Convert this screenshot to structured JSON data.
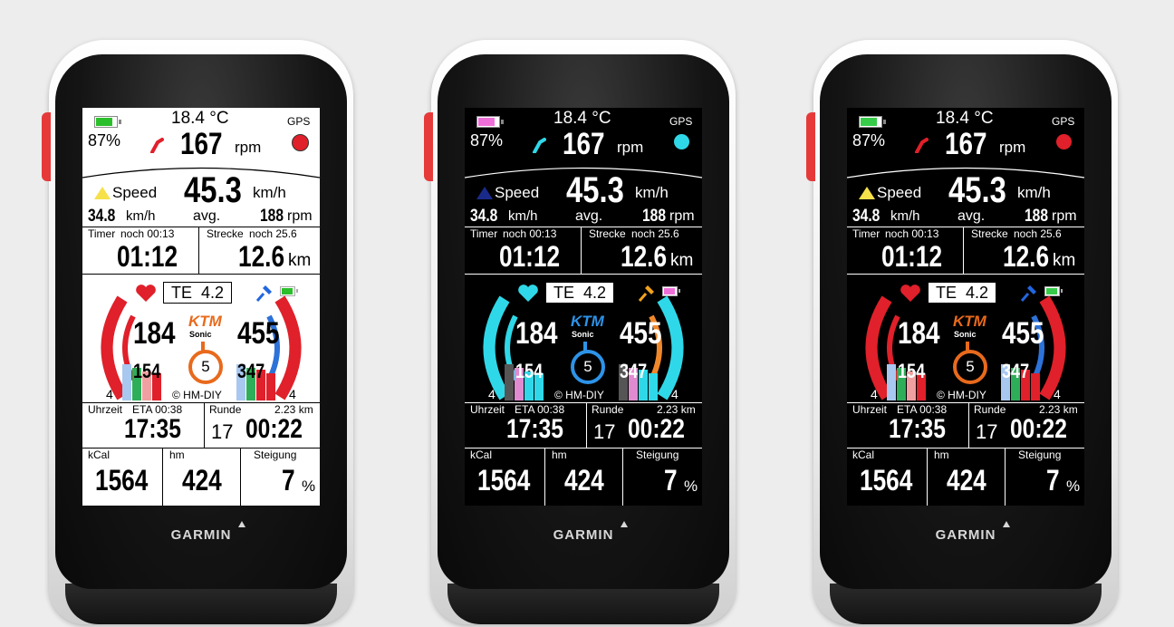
{
  "device": {
    "brand": "GARMIN"
  },
  "screen": {
    "temperature": "18.4 °C",
    "gps_label": "GPS",
    "battery_pct": "87%",
    "cadence_value": "167",
    "cadence_unit": "rpm",
    "speed_label": "Speed",
    "speed_value": "45.3",
    "speed_unit": "km/h",
    "avg_speed": "34.8",
    "avg_speed_unit": "km/h",
    "avg_label": "avg.",
    "avg_cadence": "188",
    "avg_cadence_unit": "rpm",
    "timer_label": "Timer",
    "timer_remaining": "noch 00:13",
    "timer_value": "01:12",
    "distance_label": "Strecke",
    "distance_remaining": "noch 25.6",
    "distance_value": "12.6",
    "distance_unit": "km",
    "te_label": "TE",
    "te_value": "4.2",
    "heart_rate": "184",
    "hr_avg": "154",
    "power": "455",
    "power_avg": "347",
    "left_zone": "4",
    "right_zone": "4",
    "ktm_logo": "KTM",
    "ktm_sub": "Sonic",
    "gear": "5",
    "copyright": "© HM-DIY",
    "clock_label": "Uhrzeit",
    "eta_label": "ETA 00:38",
    "clock_value": "17:35",
    "lap_label": "Runde",
    "lap_distance": "2.23 km",
    "lap_number": "17",
    "lap_time": "00:22",
    "kcal_label": "kCal",
    "kcal_value": "1564",
    "hm_label": "hm",
    "hm_value": "424",
    "grade_label": "Steigung",
    "grade_value": "7",
    "grade_unit": "%"
  },
  "variants": [
    {
      "theme": "white-red",
      "background": "#ffffff",
      "foreground": "#000000",
      "battery_color": "#2bbf2b",
      "cadence_icon_color": "#e0202a",
      "gps_dot_color": "#e0202a",
      "heart_color": "#e0202a",
      "pin_color": "#2266e0",
      "arc_left_color": "#e0202a",
      "arc_right_color": "#2d72d8",
      "arc_outer_color": "#e0202a",
      "gear_color": "#e86a1c",
      "speed_icon_color": "#f6e14a",
      "bar_colors_left": [
        "#a8c8f0",
        "#2fae5a",
        "#f0a0a0",
        "#e0202a"
      ],
      "bar_colors_right": [
        "#a8c8f0",
        "#2fae5a",
        "#e0202a",
        "#e0202a"
      ]
    },
    {
      "theme": "black-cyan",
      "background": "#000000",
      "foreground": "#ffffff",
      "battery_color": "#ef6fd8",
      "cadence_icon_color": "#2fd8e8",
      "gps_dot_color": "#2fd8e8",
      "heart_color": "#2fd8e8",
      "pin_color": "#f2a21e",
      "arc_left_color": "#2fd8e8",
      "arc_right_color": "#f0882a",
      "arc_outer_color": "#2fd8e8",
      "gear_color": "#2d93e8",
      "speed_icon_color": "#1a2a8a",
      "bar_colors_left": [
        "#555555",
        "#e08ad0",
        "#2fd8e8",
        "#2fd8e8"
      ],
      "bar_colors_right": [
        "#555555",
        "#e08ad0",
        "#2fd8e8",
        "#2fd8e8"
      ]
    },
    {
      "theme": "black-red",
      "background": "#000000",
      "foreground": "#ffffff",
      "battery_color": "#36cc4a",
      "cadence_icon_color": "#e0202a",
      "gps_dot_color": "#e0202a",
      "heart_color": "#e0202a",
      "pin_color": "#2266e0",
      "arc_left_color": "#e0202a",
      "arc_right_color": "#2d72d8",
      "arc_outer_color": "#e0202a",
      "gear_color": "#e86a1c",
      "speed_icon_color": "#f6e14a",
      "bar_colors_left": [
        "#a8c8f0",
        "#2fae5a",
        "#f0a0a0",
        "#e0202a"
      ],
      "bar_colors_right": [
        "#a8c8f0",
        "#2fae5a",
        "#e0202a",
        "#e0202a"
      ]
    }
  ]
}
